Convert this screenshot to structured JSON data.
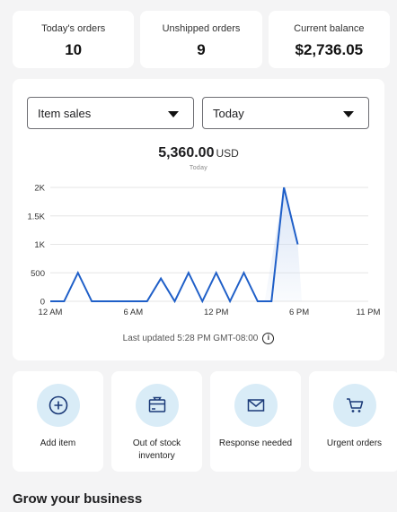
{
  "stats": [
    {
      "label": "Today's orders",
      "value": "10"
    },
    {
      "label": "Unshipped orders",
      "value": "9"
    },
    {
      "label": "Current balance",
      "value": "$2,736.05"
    }
  ],
  "filters": {
    "metric": "Item sales",
    "period": "Today"
  },
  "summary": {
    "amount": "5,360.00",
    "currency": "USD",
    "sub_label": "Today"
  },
  "chart_data": {
    "type": "line",
    "title": "",
    "xlabel": "",
    "ylabel": "",
    "x_tick_labels": [
      "12 AM",
      "6 AM",
      "12 PM",
      "6 PM",
      "11 PM"
    ],
    "x_tick_hours": [
      0,
      6,
      12,
      18,
      23
    ],
    "y_tick_labels": [
      "0",
      "500",
      "1K",
      "1.5K",
      "2K"
    ],
    "y_tick_values": [
      0,
      500,
      1000,
      1500,
      2000
    ],
    "ylim": [
      0,
      2000
    ],
    "xlim": [
      0,
      23
    ],
    "grid": true,
    "line_color": "#1f5fc8",
    "series": [
      {
        "x": [
          0,
          1,
          2,
          3,
          4,
          5,
          6,
          7,
          8,
          9,
          10,
          11,
          12,
          13,
          14,
          15,
          16,
          16.9
        ],
        "y": [
          0,
          0,
          500,
          0,
          0,
          0,
          0,
          0,
          400,
          0,
          500,
          0,
          500,
          0,
          500,
          0,
          0,
          2000
        ]
      },
      {
        "x": [
          16.9,
          17.9
        ],
        "y": [
          2000,
          1000
        ]
      }
    ]
  },
  "footer": {
    "updated": "Last updated 5:28 PM GMT-08:00"
  },
  "actions": [
    {
      "label": "Add item",
      "icon": "plus-circle-icon"
    },
    {
      "label": "Out of stock inventory",
      "icon": "box-icon"
    },
    {
      "label": "Response needed",
      "icon": "envelope-icon"
    },
    {
      "label": "Urgent orders",
      "icon": "cart-icon"
    }
  ],
  "section": {
    "title": "Grow your business"
  },
  "colors": {
    "accent": "#1f5fc8",
    "icon_bg": "#d9ecf7",
    "page_bg": "#f4f4f5"
  }
}
